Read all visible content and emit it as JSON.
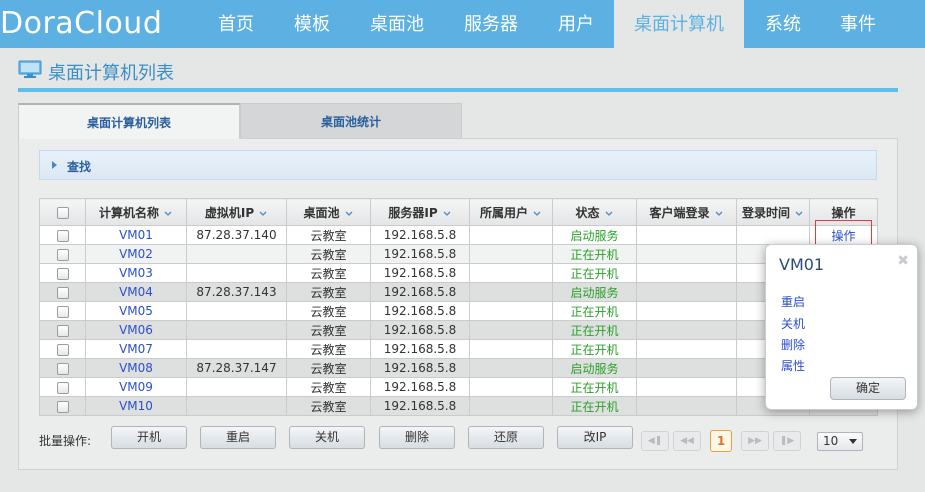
{
  "app": {
    "logo": "DoraCloud"
  },
  "nav": [
    {
      "label": "首页"
    },
    {
      "label": "模板"
    },
    {
      "label": "桌面池"
    },
    {
      "label": "服务器"
    },
    {
      "label": "用户"
    },
    {
      "label": "桌面计算机"
    },
    {
      "label": "系统"
    },
    {
      "label": "事件"
    }
  ],
  "page": {
    "title": "桌面计算机列表",
    "icon": "monitor-icon"
  },
  "tabs": [
    {
      "label": "桌面计算机列表"
    },
    {
      "label": "桌面池统计"
    }
  ],
  "search": {
    "label": "查找"
  },
  "table": {
    "headers": [
      "计算机名称",
      "虚拟机IP",
      "桌面池",
      "服务器IP",
      "所属用户",
      "状态",
      "客户端登录",
      "登录时间",
      "操作"
    ],
    "rows": [
      {
        "name": "VM01",
        "ip": "87.28.37.140",
        "pool": "云教室",
        "server": "192.168.5.8",
        "user": "",
        "status": "启动服务",
        "client": "",
        "time": "",
        "op": "操作"
      },
      {
        "name": "VM02",
        "ip": "",
        "pool": "云教室",
        "server": "192.168.5.8",
        "user": "",
        "status": "正在开机",
        "client": "",
        "time": "",
        "op": ""
      },
      {
        "name": "VM03",
        "ip": "",
        "pool": "云教室",
        "server": "192.168.5.8",
        "user": "",
        "status": "正在开机",
        "client": "",
        "time": "",
        "op": ""
      },
      {
        "name": "VM04",
        "ip": "87.28.37.143",
        "pool": "云教室",
        "server": "192.168.5.8",
        "user": "",
        "status": "启动服务",
        "client": "",
        "time": "",
        "op": ""
      },
      {
        "name": "VM05",
        "ip": "",
        "pool": "云教室",
        "server": "192.168.5.8",
        "user": "",
        "status": "正在开机",
        "client": "",
        "time": "",
        "op": ""
      },
      {
        "name": "VM06",
        "ip": "",
        "pool": "云教室",
        "server": "192.168.5.8",
        "user": "",
        "status": "正在开机",
        "client": "",
        "time": "",
        "op": ""
      },
      {
        "name": "VM07",
        "ip": "",
        "pool": "云教室",
        "server": "192.168.5.8",
        "user": "",
        "status": "正在开机",
        "client": "",
        "time": "",
        "op": ""
      },
      {
        "name": "VM08",
        "ip": "87.28.37.147",
        "pool": "云教室",
        "server": "192.168.5.8",
        "user": "",
        "status": "启动服务",
        "client": "",
        "time": "",
        "op": ""
      },
      {
        "name": "VM09",
        "ip": "",
        "pool": "云教室",
        "server": "192.168.5.8",
        "user": "",
        "status": "正在开机",
        "client": "",
        "time": "",
        "op": ""
      },
      {
        "name": "VM10",
        "ip": "",
        "pool": "云教室",
        "server": "192.168.5.8",
        "user": "",
        "status": "正在开机",
        "client": "",
        "time": "",
        "op": ""
      }
    ]
  },
  "batch": {
    "label": "批量操作:",
    "buttons": [
      "开机",
      "重启",
      "关机",
      "删除",
      "还原",
      "改IP"
    ]
  },
  "pager": {
    "current": "1",
    "page_size": "10"
  },
  "popup": {
    "title": "VM01",
    "items": [
      "重启",
      "关机",
      "删除",
      "属性"
    ],
    "ok": "确定",
    "close_icon": "close-icon"
  },
  "colors": {
    "nav_bg": "#5cb1e2",
    "link": "#2a4fd0",
    "status_green": "#2aa22a",
    "highlight": "#e23c3c"
  }
}
